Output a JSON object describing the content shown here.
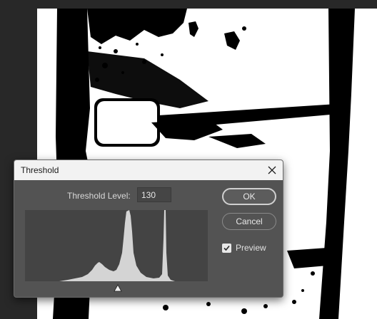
{
  "dialog": {
    "title": "Threshold",
    "level_label": "Threshold Level:",
    "level_value": "130",
    "ok_label": "OK",
    "cancel_label": "Cancel",
    "preview_label": "Preview",
    "preview_checked": true,
    "histogram_range": [
      0,
      255
    ]
  },
  "icons": {
    "close": "close-icon",
    "checkmark": "checkmark-icon",
    "slider": "slider-triangle-icon"
  },
  "colors": {
    "dialog_bg": "#535353",
    "titlebar_bg": "#f2f2f2",
    "histogram_bg": "#444444",
    "histogram_fill": "#d4d4d4",
    "workspace_bg": "#282828"
  }
}
